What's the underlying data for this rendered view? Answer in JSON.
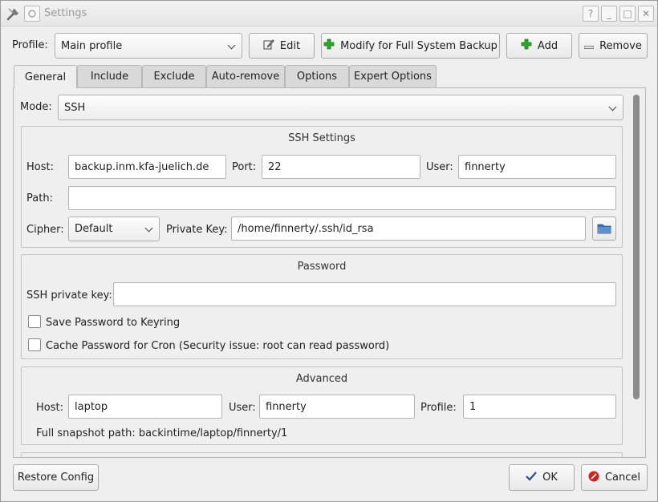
{
  "window": {
    "title": "Settings",
    "help_label": "?",
    "minimize_label": "_",
    "maximize_label": "□",
    "close_label": "✕"
  },
  "profile": {
    "label": "Profile:",
    "selected": "Main profile",
    "edit_label": "Edit",
    "modify_label": "Modify for Full System Backup",
    "add_label": "Add",
    "remove_label": "Remove"
  },
  "tabs": [
    {
      "label": "General"
    },
    {
      "label": "Include"
    },
    {
      "label": "Exclude"
    },
    {
      "label": "Auto-remove"
    },
    {
      "label": "Options"
    },
    {
      "label": "Expert Options"
    }
  ],
  "general": {
    "mode_label": "Mode:",
    "mode_value": "SSH",
    "ssh": {
      "title": "SSH Settings",
      "host_label": "Host:",
      "host_value": "backup.inm.kfa-juelich.de",
      "port_label": "Port:",
      "port_value": "22",
      "user_label": "User:",
      "user_value": "finnerty",
      "path_label": "Path:",
      "path_value": "",
      "cipher_label": "Cipher:",
      "cipher_value": "Default",
      "private_key_label": "Private Key:",
      "private_key_value": "/home/finnerty/.ssh/id_rsa"
    },
    "password": {
      "title": "Password",
      "key_label": "SSH private key:",
      "key_value": "",
      "save_keyring_label": "Save Password to Keyring",
      "cache_cron_label": "Cache Password for Cron (Security issue: root can read password)"
    },
    "advanced": {
      "title": "Advanced",
      "host_label": "Host:",
      "host_value": "laptop",
      "user_label": "User:",
      "user_value": "finnerty",
      "profile_label": "Profile:",
      "profile_value": "1",
      "snapshot_path": "Full snapshot path: backintime/laptop/finnerty/1"
    }
  },
  "footer": {
    "restore_label": "Restore Config",
    "ok_label": "OK",
    "cancel_label": "Cancel"
  },
  "colors": {
    "add_icon": "#2ea52e",
    "cancel_icon": "#cc2222",
    "folder_icon": "#3a6fb0"
  }
}
